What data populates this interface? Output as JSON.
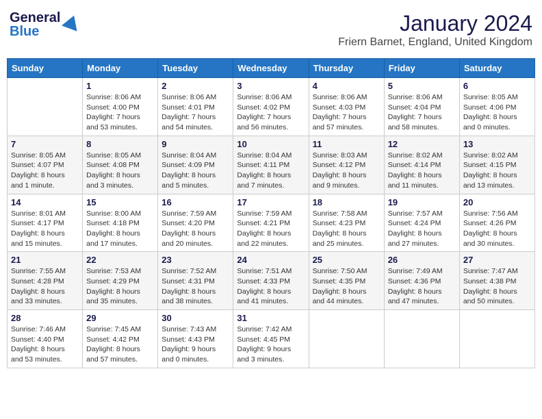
{
  "header": {
    "logo_general": "General",
    "logo_blue": "Blue",
    "month_year": "January 2024",
    "location": "Friern Barnet, England, United Kingdom"
  },
  "days_of_week": [
    "Sunday",
    "Monday",
    "Tuesday",
    "Wednesday",
    "Thursday",
    "Friday",
    "Saturday"
  ],
  "weeks": [
    [
      {
        "day": "",
        "content": ""
      },
      {
        "day": "1",
        "content": "Sunrise: 8:06 AM\nSunset: 4:00 PM\nDaylight: 7 hours\nand 53 minutes."
      },
      {
        "day": "2",
        "content": "Sunrise: 8:06 AM\nSunset: 4:01 PM\nDaylight: 7 hours\nand 54 minutes."
      },
      {
        "day": "3",
        "content": "Sunrise: 8:06 AM\nSunset: 4:02 PM\nDaylight: 7 hours\nand 56 minutes."
      },
      {
        "day": "4",
        "content": "Sunrise: 8:06 AM\nSunset: 4:03 PM\nDaylight: 7 hours\nand 57 minutes."
      },
      {
        "day": "5",
        "content": "Sunrise: 8:06 AM\nSunset: 4:04 PM\nDaylight: 7 hours\nand 58 minutes."
      },
      {
        "day": "6",
        "content": "Sunrise: 8:05 AM\nSunset: 4:06 PM\nDaylight: 8 hours\nand 0 minutes."
      }
    ],
    [
      {
        "day": "7",
        "content": "Sunrise: 8:05 AM\nSunset: 4:07 PM\nDaylight: 8 hours\nand 1 minute."
      },
      {
        "day": "8",
        "content": "Sunrise: 8:05 AM\nSunset: 4:08 PM\nDaylight: 8 hours\nand 3 minutes."
      },
      {
        "day": "9",
        "content": "Sunrise: 8:04 AM\nSunset: 4:09 PM\nDaylight: 8 hours\nand 5 minutes."
      },
      {
        "day": "10",
        "content": "Sunrise: 8:04 AM\nSunset: 4:11 PM\nDaylight: 8 hours\nand 7 minutes."
      },
      {
        "day": "11",
        "content": "Sunrise: 8:03 AM\nSunset: 4:12 PM\nDaylight: 8 hours\nand 9 minutes."
      },
      {
        "day": "12",
        "content": "Sunrise: 8:02 AM\nSunset: 4:14 PM\nDaylight: 8 hours\nand 11 minutes."
      },
      {
        "day": "13",
        "content": "Sunrise: 8:02 AM\nSunset: 4:15 PM\nDaylight: 8 hours\nand 13 minutes."
      }
    ],
    [
      {
        "day": "14",
        "content": "Sunrise: 8:01 AM\nSunset: 4:17 PM\nDaylight: 8 hours\nand 15 minutes."
      },
      {
        "day": "15",
        "content": "Sunrise: 8:00 AM\nSunset: 4:18 PM\nDaylight: 8 hours\nand 17 minutes."
      },
      {
        "day": "16",
        "content": "Sunrise: 7:59 AM\nSunset: 4:20 PM\nDaylight: 8 hours\nand 20 minutes."
      },
      {
        "day": "17",
        "content": "Sunrise: 7:59 AM\nSunset: 4:21 PM\nDaylight: 8 hours\nand 22 minutes."
      },
      {
        "day": "18",
        "content": "Sunrise: 7:58 AM\nSunset: 4:23 PM\nDaylight: 8 hours\nand 25 minutes."
      },
      {
        "day": "19",
        "content": "Sunrise: 7:57 AM\nSunset: 4:24 PM\nDaylight: 8 hours\nand 27 minutes."
      },
      {
        "day": "20",
        "content": "Sunrise: 7:56 AM\nSunset: 4:26 PM\nDaylight: 8 hours\nand 30 minutes."
      }
    ],
    [
      {
        "day": "21",
        "content": "Sunrise: 7:55 AM\nSunset: 4:28 PM\nDaylight: 8 hours\nand 33 minutes."
      },
      {
        "day": "22",
        "content": "Sunrise: 7:53 AM\nSunset: 4:29 PM\nDaylight: 8 hours\nand 35 minutes."
      },
      {
        "day": "23",
        "content": "Sunrise: 7:52 AM\nSunset: 4:31 PM\nDaylight: 8 hours\nand 38 minutes."
      },
      {
        "day": "24",
        "content": "Sunrise: 7:51 AM\nSunset: 4:33 PM\nDaylight: 8 hours\nand 41 minutes."
      },
      {
        "day": "25",
        "content": "Sunrise: 7:50 AM\nSunset: 4:35 PM\nDaylight: 8 hours\nand 44 minutes."
      },
      {
        "day": "26",
        "content": "Sunrise: 7:49 AM\nSunset: 4:36 PM\nDaylight: 8 hours\nand 47 minutes."
      },
      {
        "day": "27",
        "content": "Sunrise: 7:47 AM\nSunset: 4:38 PM\nDaylight: 8 hours\nand 50 minutes."
      }
    ],
    [
      {
        "day": "28",
        "content": "Sunrise: 7:46 AM\nSunset: 4:40 PM\nDaylight: 8 hours\nand 53 minutes."
      },
      {
        "day": "29",
        "content": "Sunrise: 7:45 AM\nSunset: 4:42 PM\nDaylight: 8 hours\nand 57 minutes."
      },
      {
        "day": "30",
        "content": "Sunrise: 7:43 AM\nSunset: 4:43 PM\nDaylight: 9 hours\nand 0 minutes."
      },
      {
        "day": "31",
        "content": "Sunrise: 7:42 AM\nSunset: 4:45 PM\nDaylight: 9 hours\nand 3 minutes."
      },
      {
        "day": "",
        "content": ""
      },
      {
        "day": "",
        "content": ""
      },
      {
        "day": "",
        "content": ""
      }
    ]
  ]
}
